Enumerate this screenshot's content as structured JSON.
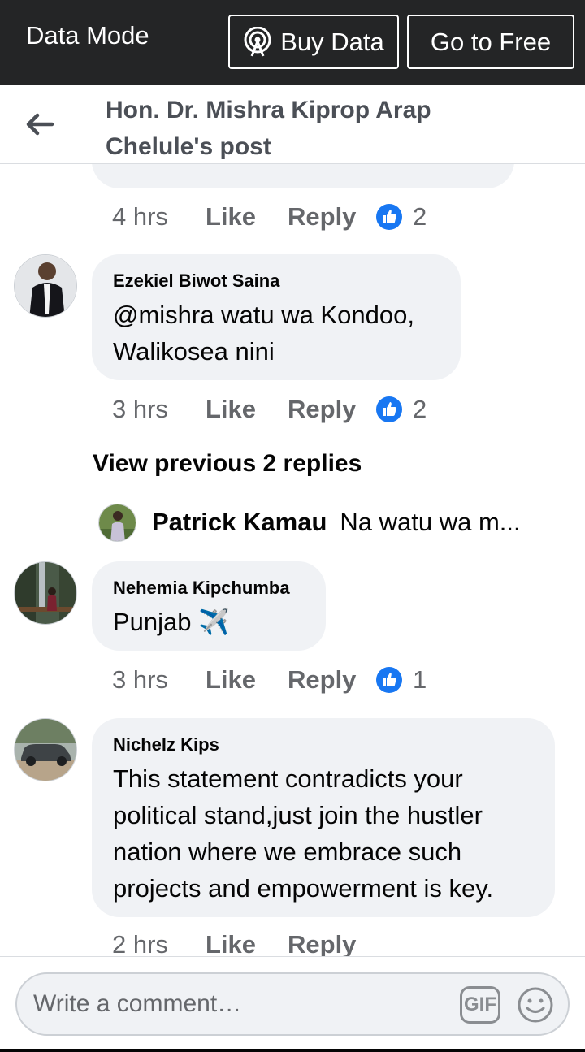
{
  "datamode": {
    "title": "Data Mode",
    "buy_label": "Buy Data",
    "free_label": "Go to Free"
  },
  "header": {
    "title": "Hon. Dr. Mishra Kiprop Arap Chelule's post"
  },
  "comments": [
    {
      "time": "4 hrs",
      "like": "Like",
      "reply": "Reply",
      "reactions": "2"
    },
    {
      "author": "Ezekiel Biwot Saina",
      "text": "@mishra watu wa Kondoo, Walikosea nini",
      "time": "3 hrs",
      "like": "Like",
      "reply": "Reply",
      "reactions": "2"
    },
    {
      "author": "Nehemia Kipchumba",
      "text": "Punjab ✈️",
      "time": "3 hrs",
      "like": "Like",
      "reply": "Reply",
      "reactions": "1"
    },
    {
      "author": "Nichelz Kips",
      "text": "This statement contradicts your political stand,just join the hustler nation where we embrace such projects and empowerment is key.",
      "time": "2 hrs",
      "like": "Like",
      "reply": "Reply"
    }
  ],
  "view_previous": "View previous 2 replies",
  "reply_preview": {
    "name": "Patrick Kamau",
    "text": "Na watu wa m..."
  },
  "composer": {
    "placeholder": "Write a comment…",
    "gif_label": "GIF"
  },
  "colors": {
    "topbar": "#242526",
    "bubble": "#f0f2f5",
    "like_blue": "#1877f2",
    "meta_gray": "#65676b"
  }
}
